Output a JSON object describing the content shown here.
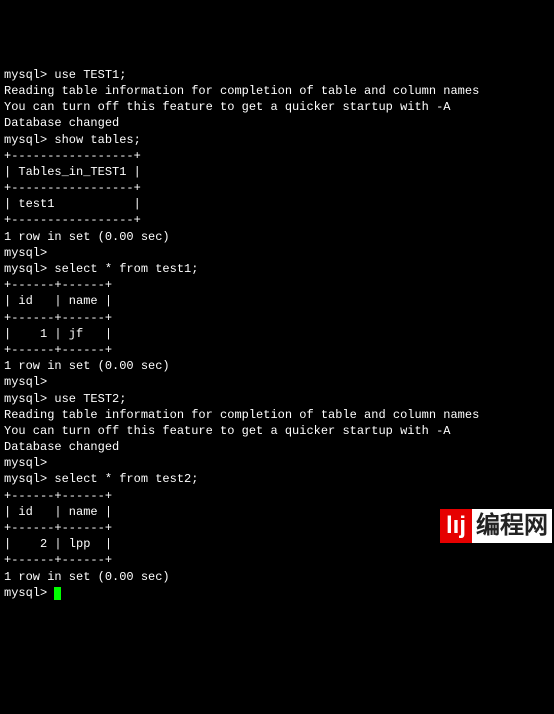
{
  "terminal": {
    "l01": "mysql> use TEST1;",
    "l02": "Reading table information for completion of table and column names",
    "l03": "You can turn off this feature to get a quicker startup with -A",
    "l04": "",
    "l05": "Database changed",
    "l06": "mysql> show tables;",
    "l07": "+-----------------+",
    "l08": "| Tables_in_TEST1 |",
    "l09": "+-----------------+",
    "l10": "| test1           |",
    "l11": "+-----------------+",
    "l12": "1 row in set (0.00 sec)",
    "l13": "",
    "l14": "mysql>",
    "l15": "mysql> select * from test1;",
    "l16": "+------+------+",
    "l17": "| id   | name |",
    "l18": "+------+------+",
    "l19": "|    1 | jf   |",
    "l20": "+------+------+",
    "l21": "1 row in set (0.00 sec)",
    "l22": "",
    "l23": "mysql>",
    "l24": "mysql> use TEST2;",
    "l25": "Reading table information for completion of table and column names",
    "l26": "You can turn off this feature to get a quicker startup with -A",
    "l27": "",
    "l28": "Database changed",
    "l29": "mysql>",
    "l30": "mysql> select * from test2;",
    "l31": "+------+------+",
    "l32": "| id   | name |",
    "l33": "+------+------+",
    "l34": "|    2 | lpp  |",
    "l35": "+------+------+",
    "l36": "1 row in set (0.00 sec)",
    "l37": "",
    "l38": "mysql> "
  },
  "watermark": {
    "badge": "lıj",
    "text": "编程网"
  }
}
